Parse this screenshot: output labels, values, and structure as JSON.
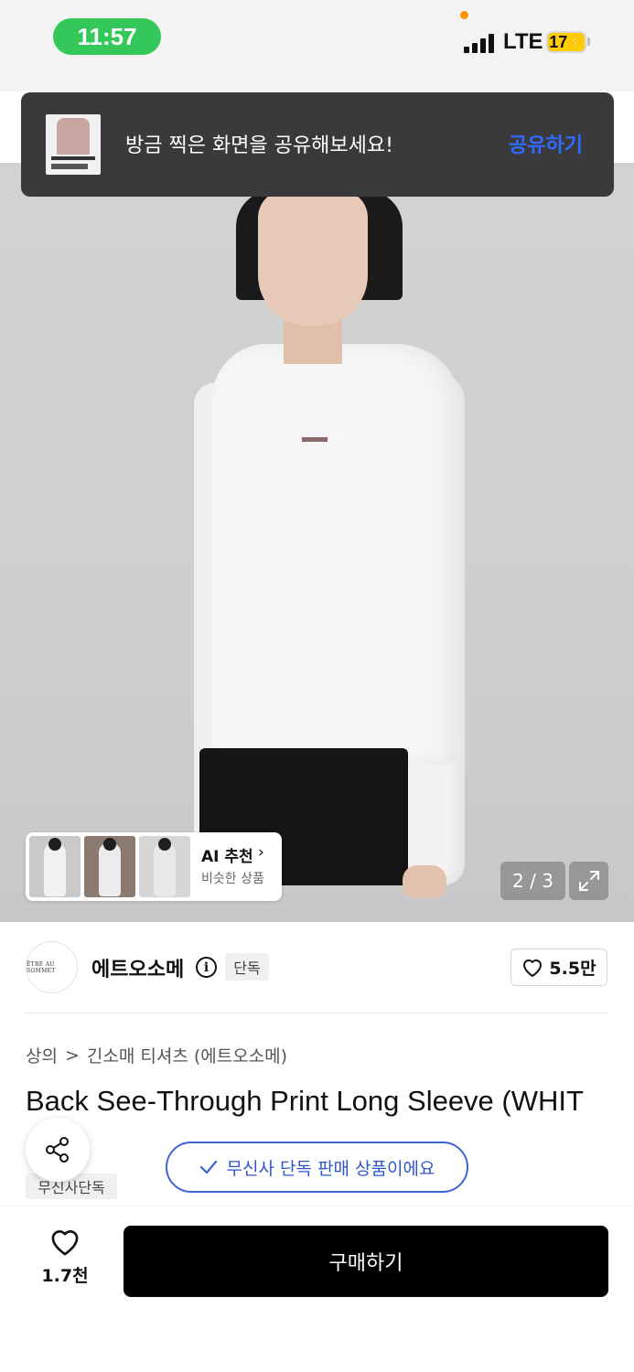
{
  "status_bar": {
    "time": "11:57",
    "network": "LTE",
    "battery": "17",
    "colors": {
      "time_pill": "#34c759",
      "battery": "#ffcc00",
      "privacy_dot": "#ff9500"
    }
  },
  "share_toast": {
    "message": "방금 찍은 화면을 공유해보세요!",
    "action_label": "공유하기",
    "colors": {
      "background": "#3a3a3c",
      "action": "#2f6bff"
    }
  },
  "gallery": {
    "counter": "2 / 3",
    "ai_recommend": {
      "title": "AI 추천",
      "subtitle": "비슷한 상품",
      "chevron": "›"
    },
    "expand_icon": "expand-icon"
  },
  "brand": {
    "logo_text": "ÊTRE AU SOMMET",
    "name": "에트오소메",
    "badge": "단독",
    "likes": "5.5만"
  },
  "product": {
    "breadcrumb": [
      "상의",
      "긴소매 티셔츠 (에트오소메)"
    ],
    "breadcrumb_separator": ">",
    "title": "Back See-Through Print Long Sleeve (WHIT",
    "exclusive_pill": "무신사 단독 판매 상품이에요",
    "exclusive_tag": "무신사단독",
    "accent_color": "#3d63d6"
  },
  "bottom_bar": {
    "like_count": "1.7천",
    "buy_label": "구매하기"
  }
}
